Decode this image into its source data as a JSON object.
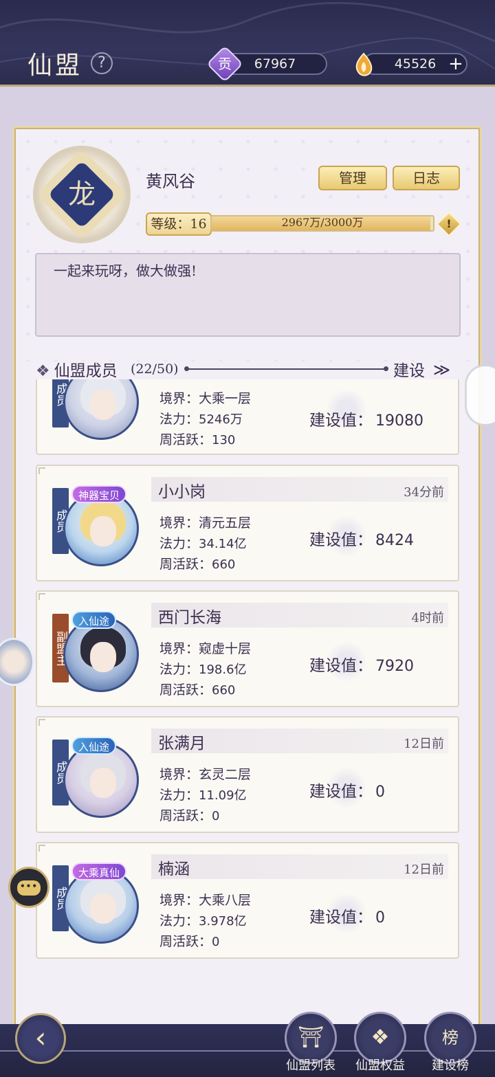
{
  "header": {
    "title": "仙盟",
    "help_symbol": "?",
    "contribution_icon_char": "贡",
    "contribution_value": "67967",
    "gold_value": "45526",
    "plus_symbol": "+"
  },
  "guild": {
    "emblem_glyph": "龙",
    "name": "黄风谷",
    "manage_label": "管理",
    "log_label": "日志",
    "level_label": "等级：16",
    "progress_text": "2967万/3000万",
    "progress_fraction": 0.989,
    "warning_symbol": "!",
    "motto": "一起来玩呀，做大做强!"
  },
  "members_header": {
    "diamond": "❖",
    "title": "仙盟成员",
    "count": "(22/50)",
    "sort_label": "建设",
    "sort_icon": "≫"
  },
  "labels": {
    "realm": "境界：",
    "power": "法力：",
    "weekly": "周活跃：",
    "build": "建设值："
  },
  "members": [
    {
      "rank": "成员",
      "name": "",
      "time": "",
      "realm": "大乘一层",
      "power": "5246万",
      "weekly": "130",
      "build": "19080",
      "badge": ""
    },
    {
      "rank": "成员",
      "name": "小小岗",
      "time": "34分前",
      "realm": "清元五层",
      "power": "34.14亿",
      "weekly": "660",
      "build": "8424",
      "badge": "神器宝贝"
    },
    {
      "rank": "副盟主",
      "name": "西门长海",
      "time": "4时前",
      "realm": "窥虚十层",
      "power": "198.6亿",
      "weekly": "660",
      "build": "7920",
      "badge": "入仙途"
    },
    {
      "rank": "成员",
      "name": "张满月",
      "time": "12日前",
      "realm": "玄灵二层",
      "power": "11.09亿",
      "weekly": "0",
      "build": "0",
      "badge": "入仙途"
    },
    {
      "rank": "成员",
      "name": "楠涵",
      "time": "12日前",
      "realm": "大乘八层",
      "power": "3.978亿",
      "weekly": "0",
      "build": "0",
      "badge": "大乘真仙"
    }
  ],
  "chat_button_text": "•••",
  "back_symbol": "‹",
  "bottom_nav": [
    {
      "label": "仙盟列表",
      "icon": "⛩",
      "icon_name": "guild-list-icon"
    },
    {
      "label": "仙盟权益",
      "icon": "❖",
      "icon_name": "guild-benefits-icon"
    },
    {
      "label": "建设榜",
      "icon": "榜",
      "icon_name": "build-ranking-icon"
    }
  ],
  "colors": {
    "topbar": "#2a2b4d",
    "gold_accent": "#e9c972",
    "rank_member": "#3a4f86",
    "rank_vice": "#9a4d2c"
  }
}
